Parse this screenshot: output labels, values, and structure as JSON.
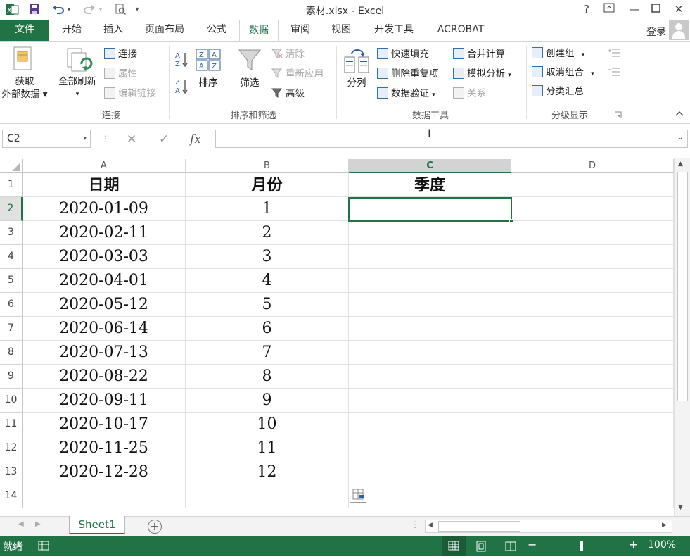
{
  "window": {
    "title": "素材.xlsx - Excel",
    "help": "?",
    "login": "登录"
  },
  "tabs": {
    "file": "文件",
    "items": [
      "开始",
      "插入",
      "页面布局",
      "公式",
      "数据",
      "审阅",
      "视图",
      "开发工具",
      "ACROBAT"
    ],
    "active": "数据"
  },
  "ribbon": {
    "get_external": {
      "line1": "获取",
      "line2": "外部数据"
    },
    "refresh_all": "全部刷新",
    "connections": {
      "connect": "连接",
      "properties": "属性",
      "edit_links": "编辑链接",
      "group": "连接"
    },
    "sort_filter": {
      "sort": "排序",
      "filter": "筛选",
      "clear": "清除",
      "reapply": "重新应用",
      "advanced": "高级",
      "group": "排序和筛选"
    },
    "data_tools": {
      "text_to_cols": "分列",
      "flash_fill": "快速填充",
      "remove_dup": "删除重复项",
      "validation": "数据验证",
      "consolidate": "合并计算",
      "what_if": "模拟分析",
      "relationships": "关系",
      "group": "数据工具"
    },
    "outline": {
      "group_btn": "创建组",
      "ungroup": "取消组合",
      "subtotal": "分类汇总",
      "group": "分级显示"
    }
  },
  "formula_bar": {
    "name_box": "C2",
    "formula": ""
  },
  "sheet": {
    "columns": [
      "A",
      "B",
      "C",
      "D"
    ],
    "selected_column": "C",
    "rows": [
      "1",
      "2",
      "3",
      "4",
      "5",
      "6",
      "7",
      "8",
      "9",
      "10",
      "11",
      "12",
      "13",
      "14"
    ],
    "selected_row": "2",
    "headers": [
      "日期",
      "月份",
      "季度"
    ],
    "data": [
      [
        "2020-01-09",
        "1"
      ],
      [
        "2020-02-11",
        "2"
      ],
      [
        "2020-03-03",
        "3"
      ],
      [
        "2020-04-01",
        "4"
      ],
      [
        "2020-05-12",
        "5"
      ],
      [
        "2020-06-14",
        "6"
      ],
      [
        "2020-07-13",
        "7"
      ],
      [
        "2020-08-22",
        "8"
      ],
      [
        "2020-09-11",
        "9"
      ],
      [
        "2020-10-17",
        "10"
      ],
      [
        "2020-11-25",
        "11"
      ],
      [
        "2020-12-28",
        "12"
      ]
    ]
  },
  "sheet_tabs": {
    "active": "Sheet1"
  },
  "status": {
    "ready": "就绪",
    "zoom": "100%"
  },
  "colors": {
    "accent": "#217346"
  }
}
